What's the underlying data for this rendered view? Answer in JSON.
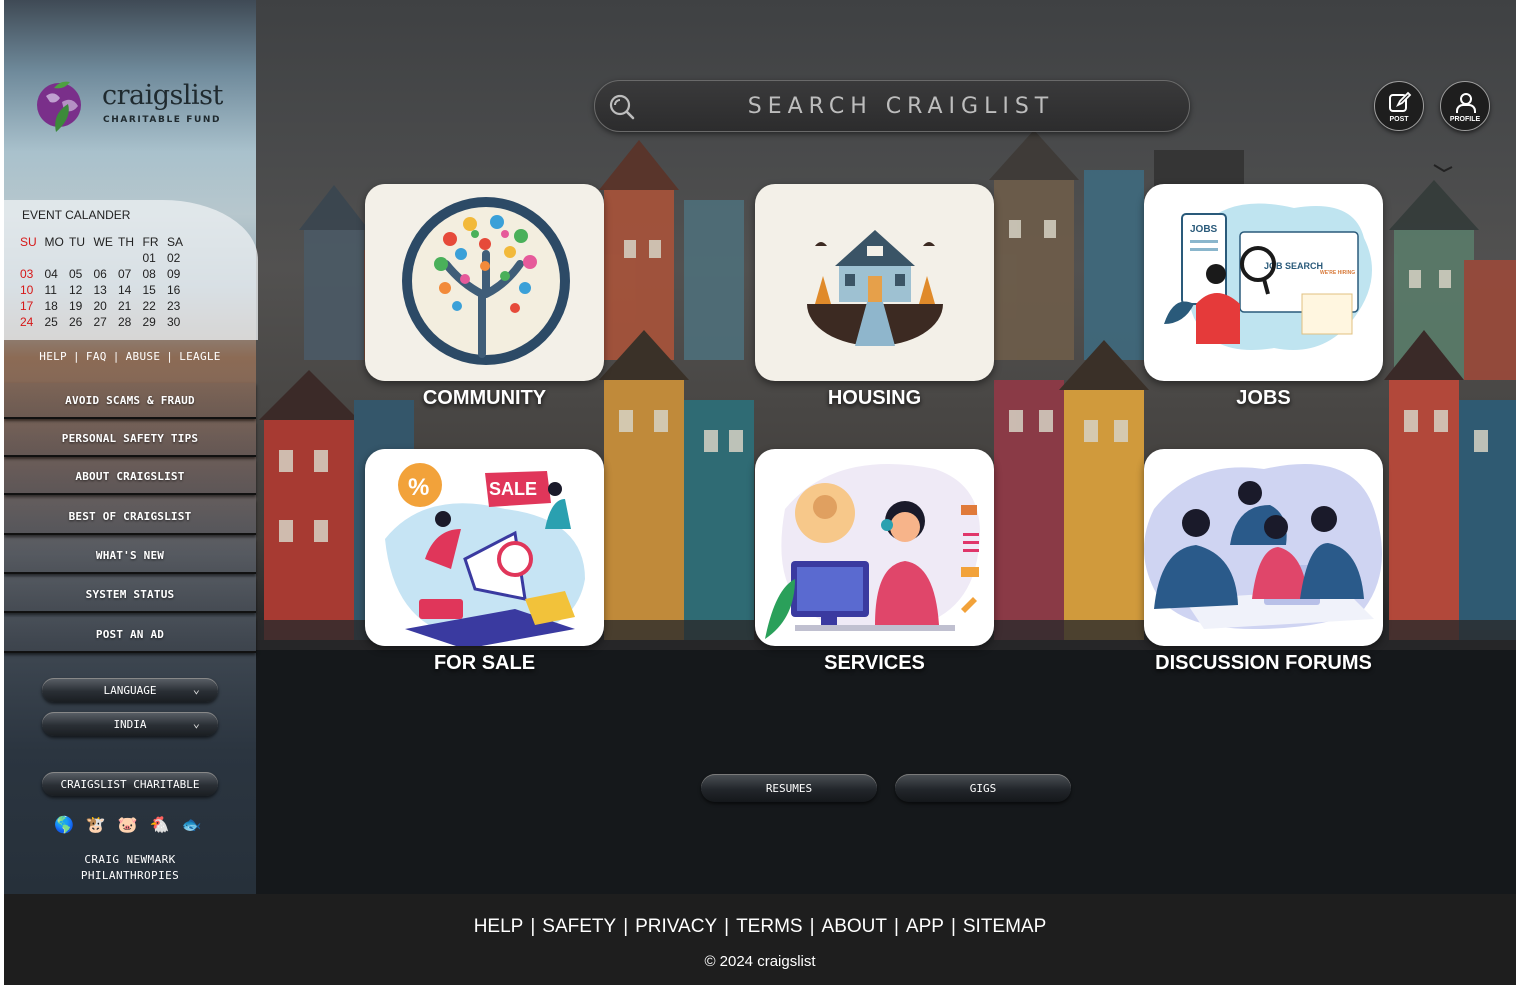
{
  "logo": {
    "word": "craigslist",
    "sub": "CHARITABLE FUND"
  },
  "calendar": {
    "title": "EVENT CALANDER",
    "days": [
      "SU",
      "MO",
      "TU",
      "WE",
      "TH",
      "FR",
      "SA"
    ],
    "weeks": [
      [
        "",
        "",
        "",
        "",
        "",
        "01",
        "02"
      ],
      [
        "03",
        "04",
        "05",
        "06",
        "07",
        "08",
        "09"
      ],
      [
        "10",
        "11",
        "12",
        "13",
        "14",
        "15",
        "16"
      ],
      [
        "17",
        "18",
        "19",
        "20",
        "21",
        "22",
        "23"
      ],
      [
        "24",
        "25",
        "26",
        "27",
        "28",
        "29",
        "30"
      ]
    ]
  },
  "help_links": [
    "HELP",
    "FAQ",
    "ABUSE",
    "LEAGLE"
  ],
  "sidebar_buttons": [
    "AVOID SCAMS & FRAUD",
    "PERSONAL SAFETY TIPS",
    "ABOUT CRAIGSLIST",
    "BEST OF CRAIGSLIST",
    "WHAT'S NEW",
    "SYSTEM STATUS",
    "POST AN AD"
  ],
  "language_select": "LANGUAGE",
  "country_select": "INDIA",
  "charitable_button": "CRAIGSLIST CHARITABLE",
  "emojis": [
    "🌎",
    "🐮",
    "🐷",
    "🐔",
    "🐟"
  ],
  "credit": {
    "line1": "CRAIG NEWMARK",
    "line2": "PHILANTHROPIES"
  },
  "search": {
    "placeholder": "SEARCH CRAIGLIST"
  },
  "header_buttons": {
    "post": "POST",
    "profile": "PROFILE"
  },
  "categories": [
    "COMMUNITY",
    "HOUSING",
    "JOBS",
    "FOR SALE",
    "SERVICES",
    "DISCUSSION FORUMS"
  ],
  "card_text": {
    "jobs": "JOBS",
    "job_search": "JOB SEARCH",
    "hiring": "WE'RE HIRING",
    "sale": "SALE",
    "percent": "%"
  },
  "sub_buttons": [
    "RESUMES",
    "GIGS"
  ],
  "footer": {
    "links": [
      "HELP",
      "SAFETY",
      "PRIVACY",
      "TERMS",
      "ABOUT",
      "APP",
      "SITEMAP"
    ],
    "copyright": "© 2024 craigslist"
  }
}
